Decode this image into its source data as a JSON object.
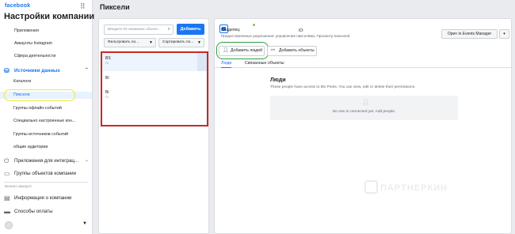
{
  "sidebar": {
    "logo": "facebook",
    "title": "Настройки компании",
    "items_top": [
      {
        "label": "Приложения"
      },
      {
        "label": "Аккаунты Instagram"
      },
      {
        "label": "Сфера деятельности"
      }
    ],
    "data_sources": {
      "label": "Источники данных",
      "items": [
        {
          "label": "Каталоги"
        },
        {
          "label": "Пиксели"
        },
        {
          "label": "Группы офлайн-событий"
        },
        {
          "label": "Специально настроенные кон..."
        },
        {
          "label": "Группы источников событий"
        },
        {
          "label": "общие аудитории"
        }
      ]
    },
    "sections": [
      {
        "label": "Приложения для интеграц...",
        "icon": "plug-icon"
      },
      {
        "label": "Группы объектов компании",
        "icon": "folder-icon"
      }
    ],
    "caption": "Бизнес-аккаунт",
    "bottom_sections": [
      {
        "label": "Информация о компании",
        "icon": "info-icon"
      },
      {
        "label": "Способы оплаты",
        "icon": "card-icon"
      }
    ]
  },
  "page": {
    "title": "Пиксели"
  },
  "pixel_list": {
    "search_placeholder": "Введите ID название объект...",
    "add_label": "Добавить",
    "filter_label": "Фильтровать по...",
    "sort_label": "Сортировать по...",
    "rows": [
      {
        "name": "BS",
        "sub": "Пі"
      },
      {
        "name": "BI",
        "sub": ""
      },
      {
        "name": "Bi",
        "sub": "Пі"
      }
    ]
  },
  "detail": {
    "owner_label": "Владелец:",
    "id_label": "ID:",
    "permissions": "Предоставленные разрешения: управление пикселями, Просмотр пикселей",
    "events_manager_label": "Open in Events Manager",
    "more_label": "▾",
    "add_people_label": "Добавить людей",
    "add_assets_label": "Добавить объекты",
    "tabs": [
      {
        "label": "Люди"
      },
      {
        "label": "Связанные объекты"
      }
    ],
    "people_title": "Люди",
    "people_subtitle": "These people have access to BS Press. You can view, edit or delete their permissions.",
    "empty_message": "No one is connected yet. Add people."
  },
  "watermark": "ПАРТНЕРКИН",
  "colors": {
    "accent": "#1877f2",
    "highlight_yellow": "#f0e63c",
    "highlight_red": "#c62828",
    "highlight_green": "#2e9e46"
  }
}
